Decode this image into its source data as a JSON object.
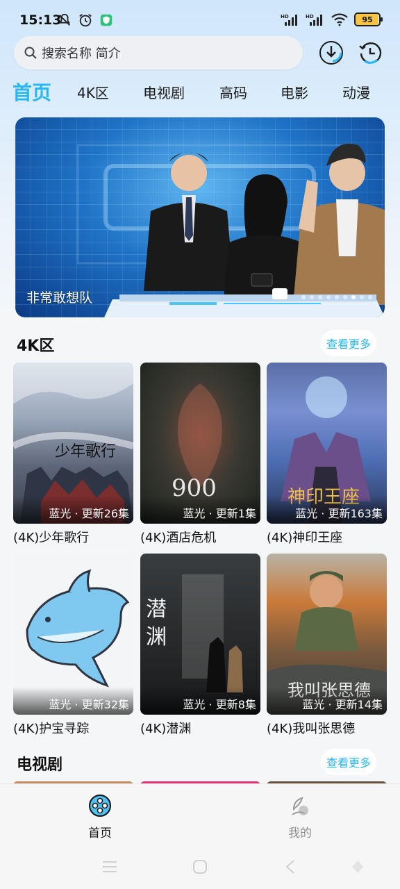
{
  "status_bar": {
    "time": "15:13",
    "battery": "95",
    "icons": [
      "mute-icon",
      "alarm-icon",
      "shield-icon",
      "hd-signal-icon",
      "hd-signal-icon",
      "wifi-icon",
      "battery-icon"
    ]
  },
  "search": {
    "placeholder": "搜索名称 简介"
  },
  "tabs": [
    {
      "label": "首页",
      "active": true
    },
    {
      "label": "4K区"
    },
    {
      "label": "电视剧"
    },
    {
      "label": "高码"
    },
    {
      "label": "电影"
    },
    {
      "label": "动漫"
    }
  ],
  "banner": {
    "title": "非常敢想队",
    "dots": 9,
    "active_dot": 7
  },
  "sections": [
    {
      "title": "4K区",
      "more_label": "查看更多",
      "items": [
        {
          "title": "(4K)少年歌行",
          "badge": "蓝光 · 更新26集"
        },
        {
          "title": "(4K)酒店危机",
          "badge": "蓝光 · 更新1集"
        },
        {
          "title": "(4K)神印王座",
          "badge": "蓝光 · 更新163集"
        },
        {
          "title": "(4K)护宝寻踪",
          "badge": "蓝光 · 更新32集"
        },
        {
          "title": "(4K)潜渊",
          "badge": "蓝光 · 更新8集"
        },
        {
          "title": "(4K)我叫张思德",
          "badge": "蓝光 · 更新14集"
        }
      ]
    },
    {
      "title": "电视剧",
      "more_label": "查看更多"
    }
  ],
  "bottom_nav": [
    {
      "label": "首页",
      "active": true
    },
    {
      "label": "我的"
    }
  ],
  "colors": {
    "accent": "#27b7f2"
  }
}
